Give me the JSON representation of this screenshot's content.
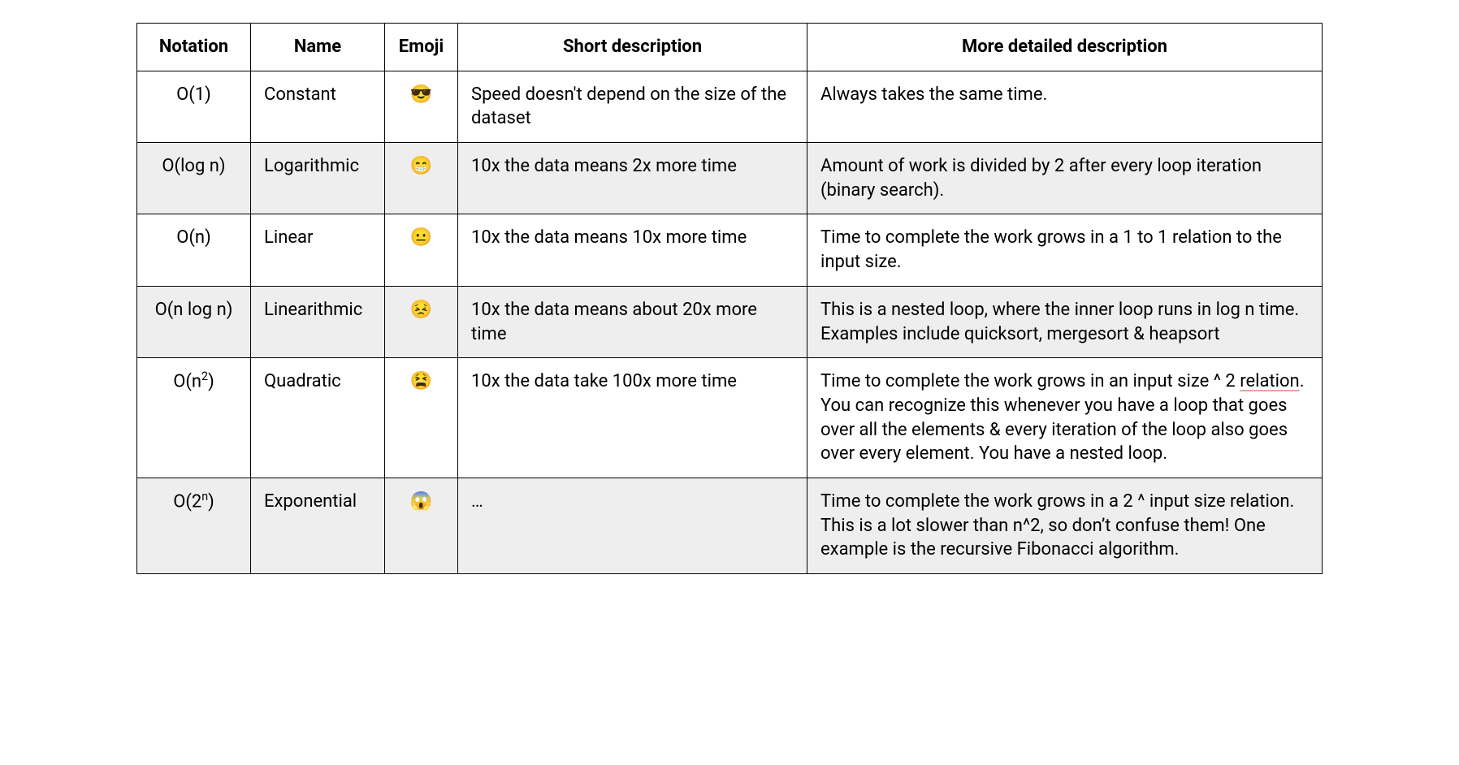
{
  "columns": {
    "notation": "Notation",
    "name": "Name",
    "emoji": "Emoji",
    "short": "Short description",
    "detail": "More detailed description"
  },
  "rows": [
    {
      "notation_html": "O(1)",
      "name": "Constant",
      "emoji": "😎",
      "short": "Speed doesn't depend on the size of the dataset",
      "detail_html": "Always takes the same time."
    },
    {
      "notation_html": "O(log n)",
      "name": "Logarithmic",
      "emoji": "😁",
      "short": "10x the data means 2x more time",
      "detail_html": "Amount of work is divided by 2 after every loop iteration (binary search)."
    },
    {
      "notation_html": "O(n)",
      "name": "Linear",
      "emoji": "😐",
      "short": "10x the data means 10x more time",
      "detail_html": "Time to complete the work grows in a 1 to 1 relation to the input size."
    },
    {
      "notation_html": "O(n log n)",
      "name": "Linearithmic",
      "emoji": "😣",
      "short": "10x the data means about 20x more time",
      "detail_html": "This is a nested loop, where the inner loop runs in log n time. Examples include quicksort, mergesort & heapsort"
    },
    {
      "notation_html": "O(n<sup>2</sup>)",
      "name": "Quadratic",
      "emoji": "😫",
      "short": "10x the data take 100x more time",
      "detail_html": "Time to complete the work grows in an input size ^ 2 <span class=\"spell-underline\">relation</span>. You can recognize this whenever you have a loop that goes over all the elements & every iteration of the loop also goes over every element. You have a nested loop."
    },
    {
      "notation_html": "O(2<sup>n</sup>)",
      "name": "Exponential",
      "emoji": "😱",
      "short": "…",
      "detail_html": "Time to complete the work grows in a 2 ^ input size relation. This is a lot slower than n^2, so don’t confuse them! One example is the recursive Fibonacci algorithm."
    }
  ]
}
